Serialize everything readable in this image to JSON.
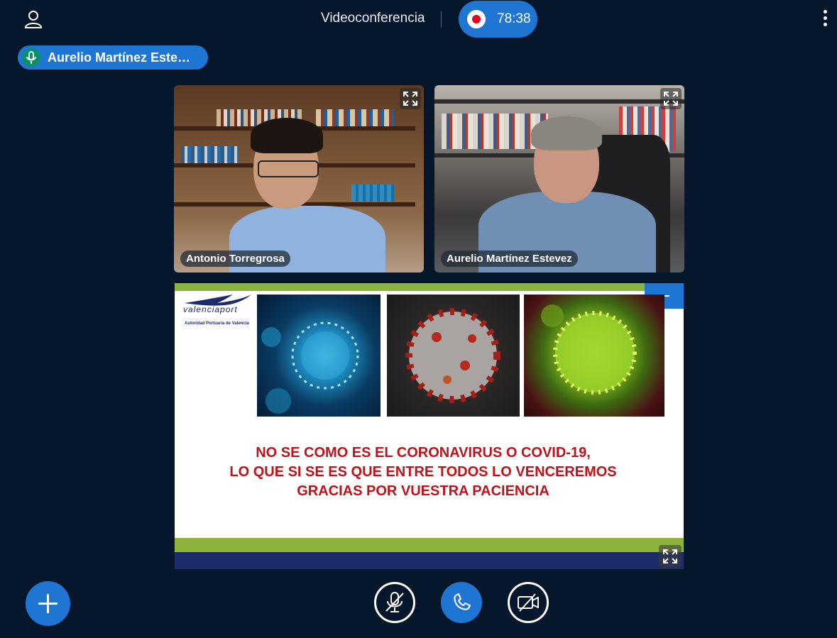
{
  "header": {
    "title": "Videoconferencia",
    "recording_time": "78:38"
  },
  "talking_indicator": {
    "name": "Aurelio Martínez Este…"
  },
  "participants": [
    {
      "name": "Antonio Torregrosa"
    },
    {
      "name": "Aurelio Martínez Estevez"
    }
  ],
  "presentation": {
    "logo_text": "valenciaport",
    "logo_subtitle": "Autoridad Portuaria de Valencia",
    "lines": [
      "NO SE COMO ES EL CORONAVIRUS O COVID-19,",
      "LO QUE SI SE ES QUE ENTRE TODOS LO VENCEREMOS",
      "GRACIAS POR VUESTRA PACIENCIA"
    ]
  },
  "colors": {
    "background": "#06172b",
    "accent": "#1f76d2",
    "record": "#e1091b",
    "slide_text": "#c0121a",
    "slide_green": "#8cb33a",
    "slide_navy": "#1d2a6b"
  },
  "icons": {
    "user": "user-icon",
    "more": "more-vertical-icon",
    "record": "record-icon",
    "mic": "microphone-icon",
    "expand": "expand-icon",
    "minimize": "minimize-icon",
    "add": "plus-icon",
    "mic_off": "microphone-off-icon",
    "phone": "phone-icon",
    "camera_off": "camera-off-icon"
  }
}
